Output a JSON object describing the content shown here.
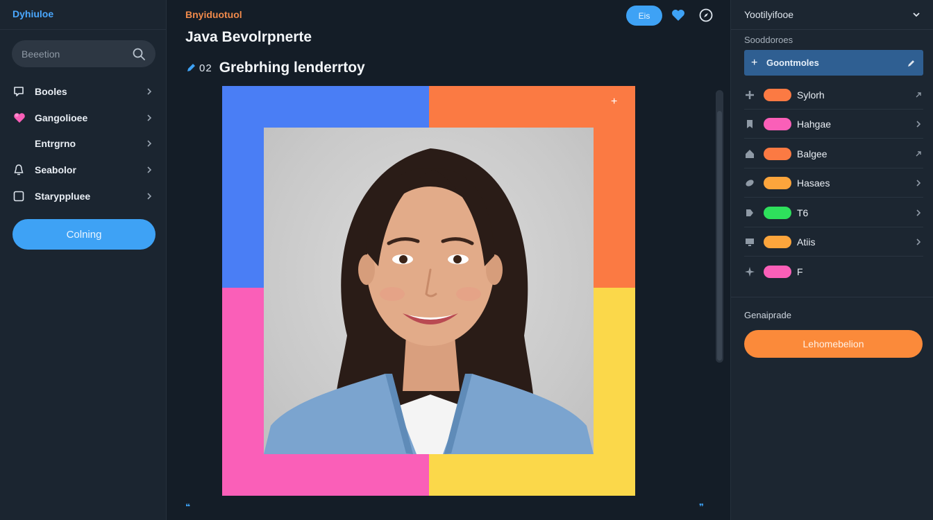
{
  "sidebar": {
    "brand": "Dyhiuloe",
    "search_placeholder": "Beeetion",
    "items": [
      {
        "label": "Booles",
        "icon": "chat-bubble-icon"
      },
      {
        "label": "Gangolioee",
        "icon": "heart-group-icon"
      },
      {
        "label": "Entrgrno",
        "icon": ""
      },
      {
        "label": "Seabolor",
        "icon": "bell-icon"
      },
      {
        "label": "Staryppluee",
        "icon": "square-icon"
      }
    ],
    "cta_label": "Colning"
  },
  "main": {
    "eyebrow": "Bnyiduotuol",
    "title": "Java Bevolrpnerte",
    "subtitle_number": "02",
    "subtitle": "Grebrhing lenderrtoy",
    "top_pill_label": "Eis",
    "colors": {
      "top_left": "#4a7ef5",
      "top_right": "#fb7a43",
      "bottom_left": "#fa5fb8",
      "bottom_right": "#fbd84a",
      "accent": "#3ea2f5"
    }
  },
  "panel": {
    "header": "Yootilyifooe",
    "section_label": "Sooddoroes",
    "add_label": "Goontmoles",
    "tags": [
      {
        "label": "Sylorh",
        "color": "#fb7a43"
      },
      {
        "label": "Hahgae",
        "color": "#fa5fb8"
      },
      {
        "label": "Balgee",
        "color": "#fb7a43"
      },
      {
        "label": "Hasaes",
        "color": "#fca53c"
      },
      {
        "label": "T6",
        "color": "#2ee05c"
      },
      {
        "label": "Atiis",
        "color": "#fca53c"
      },
      {
        "label": "F",
        "color": "#fa5fb8"
      }
    ],
    "footer_section": "Genaiprade",
    "footer_button": "Lehomebelion"
  }
}
